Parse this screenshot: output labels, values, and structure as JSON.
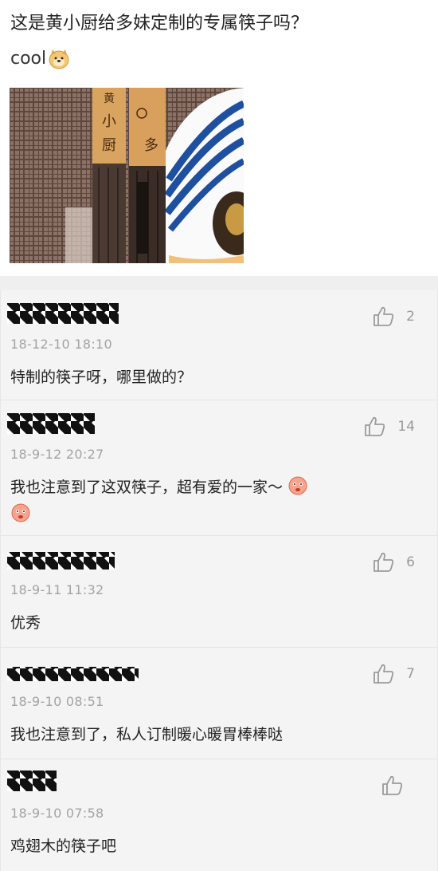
{
  "post": {
    "title": "这是黄小厨给多妹定制的专属筷子吗？",
    "subtitle": "cool",
    "emoji": "doge-emoji",
    "photo_marks": {
      "left_chopstick": [
        "黄",
        "小",
        "厨"
      ],
      "right_chopstick": "多"
    }
  },
  "comments": [
    {
      "date": "18-12-10 18:10",
      "text": "特制的筷子呀，哪里做的？",
      "likes": "2"
    },
    {
      "date": "18-9-12 20:27",
      "text": "我也注意到了这双筷子，超有爱的一家～",
      "likes": "14",
      "emoji": "blush-face-emoji"
    },
    {
      "date": "18-9-11 11:32",
      "text": "优秀",
      "likes": "6"
    },
    {
      "date": "18-9-10 08:51",
      "text": "我也注意到了，私人订制暖心暖胃棒棒哒",
      "likes": "7"
    },
    {
      "date": "18-9-10 07:58",
      "text": "鸡翅木的筷子吧",
      "likes": ""
    }
  ],
  "colors": {
    "background": "#ffffff",
    "comment_bg": "#f4f4f4",
    "date": "#a3a3a3",
    "like_icon": "#9a9a9a"
  },
  "icons": [
    "thumbs-up-icon",
    "doge-emoji",
    "blush-face-emoji"
  ]
}
